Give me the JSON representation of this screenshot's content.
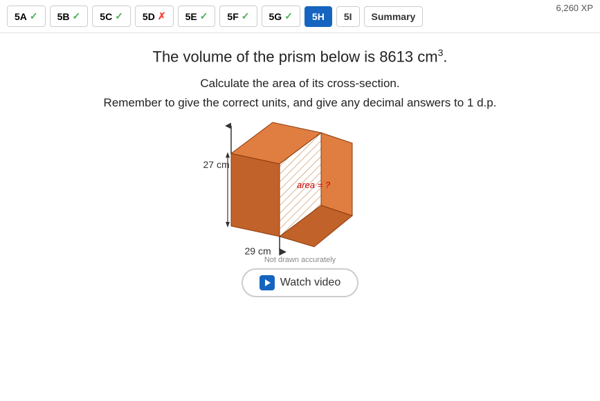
{
  "xp": {
    "value": "6,260 XP"
  },
  "tabs": [
    {
      "id": "5A",
      "label": "5A",
      "status": "check",
      "symbol": "✓"
    },
    {
      "id": "5B",
      "label": "5B",
      "status": "check",
      "symbol": "✓"
    },
    {
      "id": "5C",
      "label": "5C",
      "status": "check",
      "symbol": "✓"
    },
    {
      "id": "5D",
      "label": "5D",
      "status": "cross",
      "symbol": "✗"
    },
    {
      "id": "5E",
      "label": "5E",
      "status": "check",
      "symbol": "✓"
    },
    {
      "id": "5F",
      "label": "5F",
      "status": "check",
      "symbol": "✓"
    },
    {
      "id": "5G",
      "label": "5G",
      "status": "check",
      "symbol": "✓"
    },
    {
      "id": "5H",
      "label": "5H",
      "status": "active",
      "symbol": ""
    },
    {
      "id": "5I",
      "label": "5I",
      "status": "plain",
      "symbol": ""
    },
    {
      "id": "summary",
      "label": "Summary",
      "status": "summary",
      "symbol": ""
    }
  ],
  "problem": {
    "volume_text": "The volume of the prism below is 8613 cm",
    "volume_exponent": "3",
    "instruction_line1": "Calculate the area of its cross-section.",
    "instruction_line2": "Remember to give the correct units, and give any decimal answers to 1 d.p.",
    "label_height": "27 cm",
    "label_width": "29 cm",
    "area_label": "area = ?",
    "not_drawn": "Not drawn accurately"
  },
  "watch_button": {
    "label": "Watch video"
  }
}
